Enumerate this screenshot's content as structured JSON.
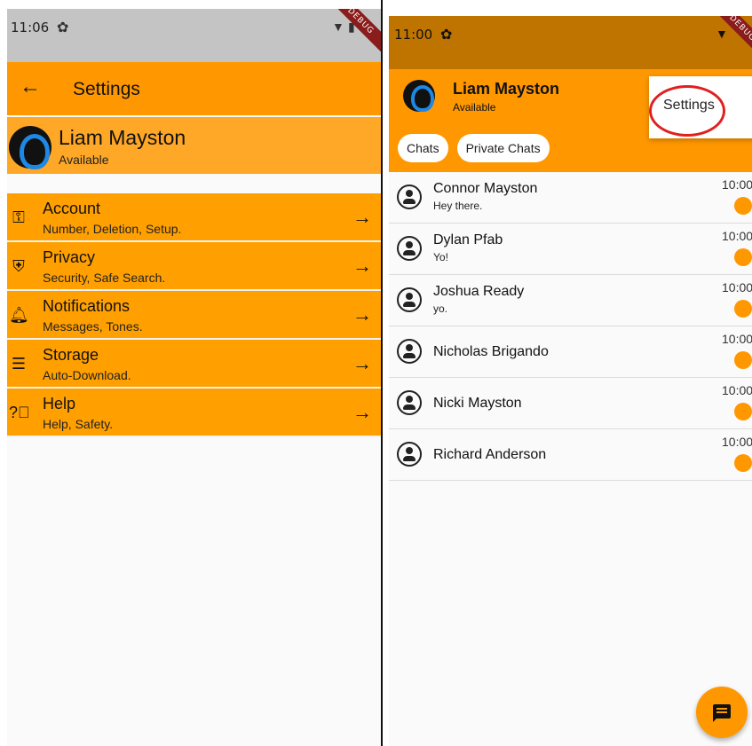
{
  "left": {
    "status_time": "11:06",
    "debug_label": "DEBUG",
    "appbar_title": "Settings",
    "profile": {
      "name": "Liam Mayston",
      "status": "Available"
    },
    "menu": [
      {
        "icon": "key-icon",
        "title": "Account",
        "subtitle": "Number, Deletion, Setup."
      },
      {
        "icon": "shield-icon",
        "title": "Privacy",
        "subtitle": "Security, Safe Search."
      },
      {
        "icon": "bell-icon",
        "title": "Notifications",
        "subtitle": "Messages, Tones."
      },
      {
        "icon": "storage-icon",
        "title": "Storage",
        "subtitle": "Auto-Download."
      },
      {
        "icon": "help-icon",
        "title": "Help",
        "subtitle": "Help, Safety."
      }
    ]
  },
  "right": {
    "status_time": "11:00",
    "debug_label": "DEBUG",
    "profile": {
      "name": "Liam Mayston",
      "status": "Available"
    },
    "chips": [
      "Chats",
      "Private Chats"
    ],
    "popup_menu": {
      "item": "Settings"
    },
    "chats": [
      {
        "name": "Connor Mayston",
        "message": "Hey there.",
        "time": "10:00"
      },
      {
        "name": "Dylan Pfab",
        "message": "Yo!",
        "time": "10:00"
      },
      {
        "name": "Joshua Ready",
        "message": "yo.",
        "time": "10:00"
      },
      {
        "name": "Nicholas Brigando",
        "message": "",
        "time": "10:00"
      },
      {
        "name": "Nicki Mayston",
        "message": "",
        "time": "10:00"
      },
      {
        "name": "Richard Anderson",
        "message": "",
        "time": "10:00"
      }
    ],
    "fab_icon": "chat-icon"
  },
  "colors": {
    "accent": "#ff9800",
    "accent_light": "#ffa726",
    "annotation": "#e02020"
  }
}
